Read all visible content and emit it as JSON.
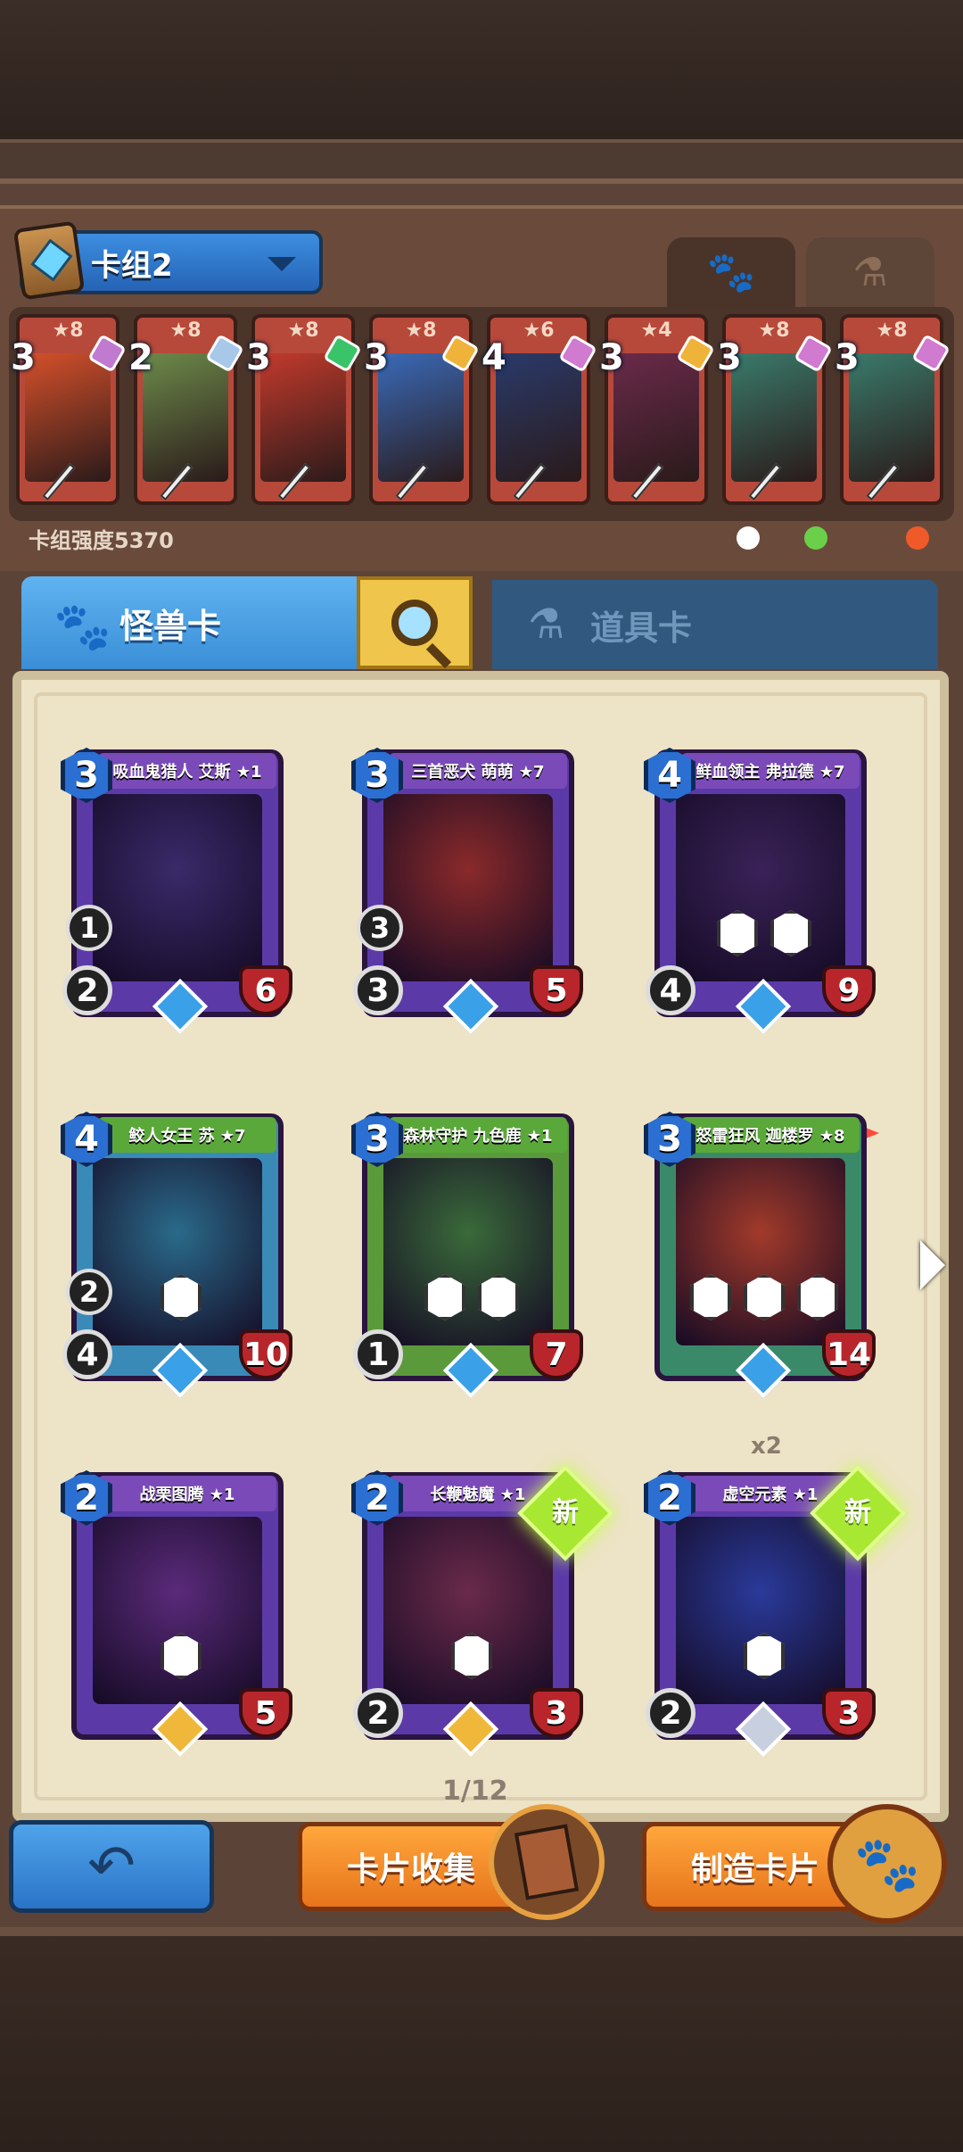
{
  "deck": {
    "name": "卡组2",
    "power_label": "卡组强度5370"
  },
  "deck_cards": [
    {
      "cost": "3",
      "stars": "★8",
      "art": "#d4502a",
      "gem": "#c07ad0"
    },
    {
      "cost": "2",
      "stars": "★8",
      "art": "#6d8a4a",
      "gem": "#a7c8e8"
    },
    {
      "cost": "3",
      "stars": "★8",
      "art": "#c23a2c",
      "gem": "#3ac46a"
    },
    {
      "cost": "3",
      "stars": "★8",
      "art": "#3a6ab8",
      "gem": "#f0b33a"
    },
    {
      "cost": "4",
      "stars": "★6",
      "art": "#2a3a6a",
      "gem": "#d07ad0"
    },
    {
      "cost": "3",
      "stars": "★4",
      "art": "#6a2a4a",
      "gem": "#f0b33a"
    },
    {
      "cost": "3",
      "stars": "★8",
      "art": "#3a7a6a",
      "gem": "#d07ad0"
    },
    {
      "cost": "3",
      "stars": "★8",
      "art": "#3a7a6a",
      "gem": "#d07ad0"
    }
  ],
  "tabs": {
    "monster": "怪兽卡",
    "items": "道具卡"
  },
  "cards": [
    {
      "name": "吸血鬼猎人 艾斯 ★1",
      "mana": "3",
      "atk": "2",
      "hp": "6",
      "spd": "1",
      "frame": "#5b3aa8",
      "art": "#3a2a6a",
      "banner": "#7a4ab8",
      "rarity": "#3aa0e8",
      "abilities": 0
    },
    {
      "name": "三首恶犬 萌萌 ★7",
      "mana": "3",
      "atk": "3",
      "hp": "5",
      "spd": "3",
      "frame": "#5b3aa8",
      "art": "#8a2a2a",
      "banner": "#7a4ab8",
      "rarity": "#3aa0e8",
      "abilities": 0
    },
    {
      "name": "鲜血领主 弗拉德 ★7",
      "mana": "4",
      "atk": "4",
      "hp": "9",
      "spd": "",
      "frame": "#5b3aa8",
      "art": "#3a2258",
      "banner": "#7a4ab8",
      "rarity": "#3aa0e8",
      "abilities": 2
    },
    {
      "name": "鲛人女王 苏 ★7",
      "mana": "4",
      "atk": "4",
      "hp": "10",
      "spd": "2",
      "frame": "#3a8ab8",
      "art": "#2a6a8a",
      "banner": "#5aa83a",
      "rarity": "#3aa0e8",
      "abilities": 1
    },
    {
      "name": "森林守护 九色鹿 ★1",
      "mana": "3",
      "atk": "1",
      "hp": "7",
      "spd": "",
      "frame": "#5a9a3a",
      "art": "#3a6a3a",
      "banner": "#5aa83a",
      "rarity": "#3aa0e8",
      "abilities": 2
    },
    {
      "name": "怒雷狂风 迦楼罗 ★8",
      "mana": "3",
      "atk": "",
      "hp": "14",
      "spd": "",
      "frame": "#3a8a6a",
      "art": "#a23a2a",
      "banner": "#5aa83a",
      "rarity": "#3aa0e8",
      "abilities": 3
    },
    {
      "name": "战栗图腾 ★1",
      "mana": "2",
      "atk": "",
      "hp": "5",
      "spd": "",
      "frame": "#5b3aa8",
      "art": "#5a2a7a",
      "banner": "#7a4ab8",
      "rarity": "#f0b83a",
      "abilities": 1
    },
    {
      "name": "长鞭魅魔 ★1",
      "mana": "2",
      "atk": "2",
      "hp": "3",
      "spd": "",
      "frame": "#5b3aa8",
      "art": "#6a2a4a",
      "banner": "#7a4ab8",
      "rarity": "#f0b83a",
      "abilities": 1
    },
    {
      "name": "虚空元素 ★1",
      "mana": "2",
      "atk": "2",
      "hp": "3",
      "spd": "",
      "frame": "#5b3aa8",
      "art": "#2a3a9a",
      "banner": "#7a4ab8",
      "rarity": "#c8d0e0",
      "abilities": 1
    }
  ],
  "badges": {
    "new": "新",
    "dup": "x2",
    "owned_flag": "1"
  },
  "pagination": {
    "label": "1/12"
  },
  "buttons": {
    "back": "↶",
    "collect": "卡片收集",
    "craft": "制造卡片"
  },
  "icons": {
    "deck_book": "book-icon",
    "paw": "paw-icon",
    "potion": "potion-icon",
    "search": "search-icon",
    "next": "chevron-right-icon"
  },
  "element_dots": [
    "#ffffff",
    "#6a4a3a",
    "#6ad04a",
    "#6a4a3a",
    "#6a4a3a",
    "#f05a2a"
  ]
}
